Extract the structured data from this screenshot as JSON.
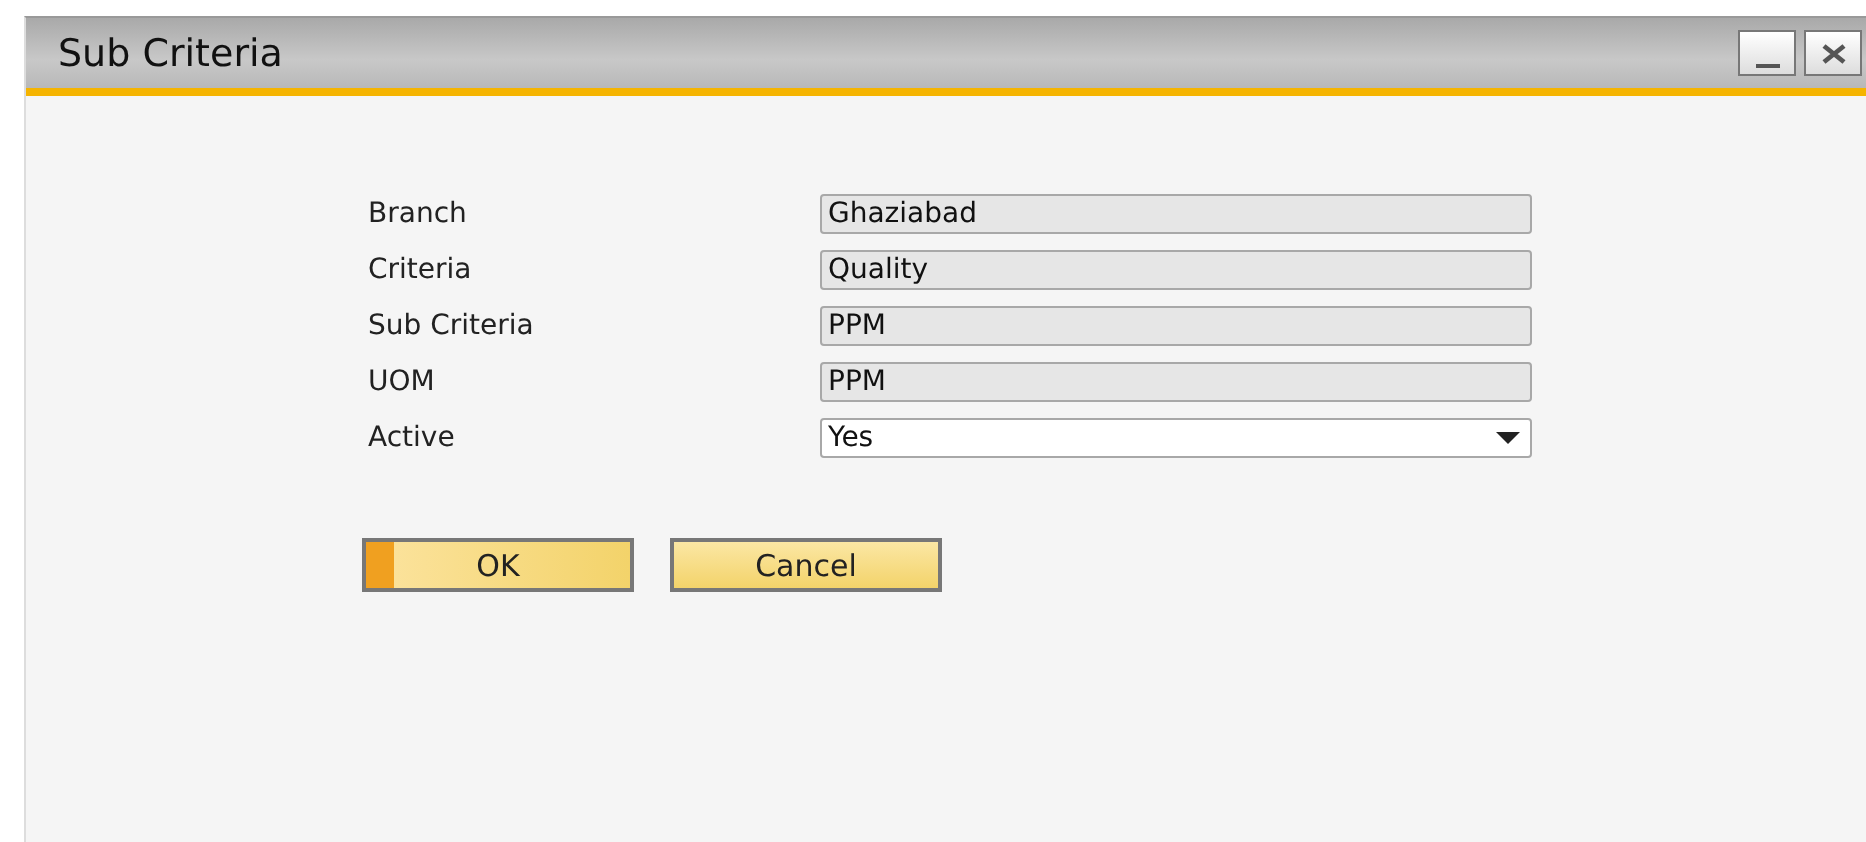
{
  "window": {
    "title": "Sub Criteria"
  },
  "fields": [
    {
      "label": "Branch",
      "value": "Ghaziabad",
      "kind": "readonly"
    },
    {
      "label": "Criteria",
      "value": "Quality",
      "kind": "readonly"
    },
    {
      "label": "Sub Criteria",
      "value": "PPM",
      "kind": "readonly"
    },
    {
      "label": "UOM",
      "value": "PPM",
      "kind": "readonly"
    },
    {
      "label": "Active",
      "value": "Yes",
      "kind": "dropdown"
    }
  ],
  "buttons": [
    {
      "label": "OK",
      "default": true
    },
    {
      "label": "Cancel",
      "default": false
    }
  ]
}
